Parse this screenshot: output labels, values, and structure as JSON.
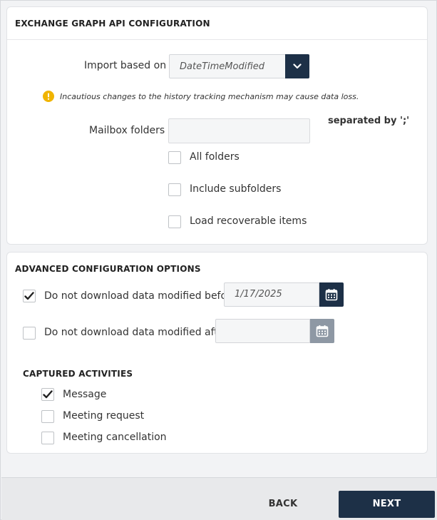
{
  "exchange": {
    "header": "EXCHANGE GRAPH API CONFIGURATION",
    "import_label": "Import based on",
    "import_value": "DateTimeModified",
    "warning": "Incautious changes to the history tracking mechanism may cause data loss.",
    "mailbox_label": "Mailbox folders",
    "mailbox_value": "",
    "separator_hint": "separated by ';'",
    "options": [
      {
        "label": "All folders",
        "checked": false
      },
      {
        "label": "Include subfolders",
        "checked": false
      },
      {
        "label": "Load recoverable items",
        "checked": false
      }
    ]
  },
  "advanced": {
    "header": "ADVANCED CONFIGURATION OPTIONS",
    "before_label": "Do not download data modified before:",
    "before_checked": true,
    "before_value": "1/17/2025",
    "after_label": "Do not download data modified after:",
    "after_checked": false,
    "after_value": "",
    "activities_title": "CAPTURED ACTIVITIES",
    "activities": [
      {
        "label": "Message",
        "checked": true
      },
      {
        "label": "Meeting request",
        "checked": false
      },
      {
        "label": "Meeting cancellation",
        "checked": false
      }
    ]
  },
  "footer": {
    "back_label": "BACK",
    "next_label": "NEXT"
  },
  "colors": {
    "primary": "#1d3047",
    "disabled": "#8e98a4",
    "warning": "#f0b400"
  },
  "icons": {
    "dropdown": "chevron-down-icon",
    "warning": "warning-icon",
    "calendar": "calendar-icon",
    "check": "checkmark-icon"
  }
}
